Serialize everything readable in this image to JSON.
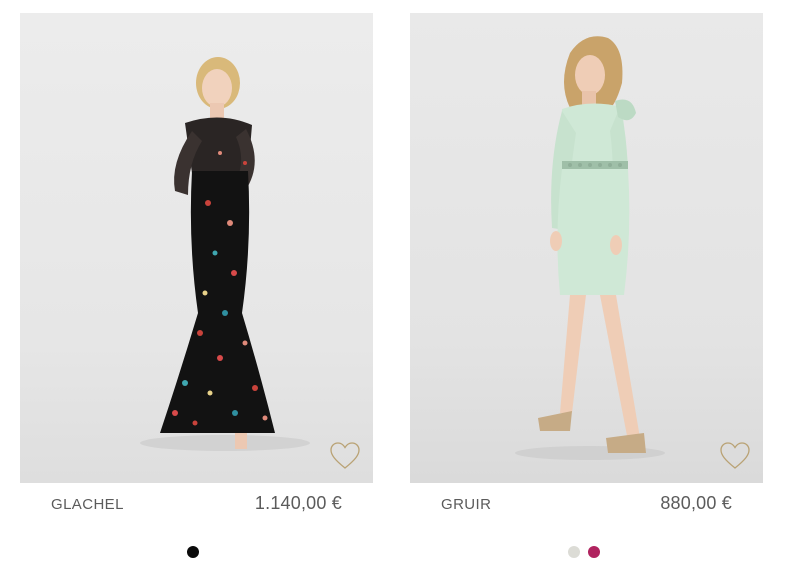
{
  "products": [
    {
      "name": "GLACHEL",
      "price": "1.140,00 €",
      "image_description_icon": "model-black-floral-gown",
      "wishlist_icon": "heart-outline-icon",
      "swatches": [
        {
          "color": "#0a0a0a"
        }
      ]
    },
    {
      "name": "GRUIR",
      "price": "880,00 €",
      "image_description_icon": "model-mint-cocktail-dress",
      "wishlist_icon": "heart-outline-icon",
      "swatches": [
        {
          "color": "#dcdcd6"
        },
        {
          "color": "#b0235f"
        }
      ]
    }
  ],
  "colors": {
    "heart_stroke": "#b9a274",
    "text": "#5b5b5b",
    "gown_dress": "#111111",
    "mint_dress": "#cfe8d6"
  }
}
